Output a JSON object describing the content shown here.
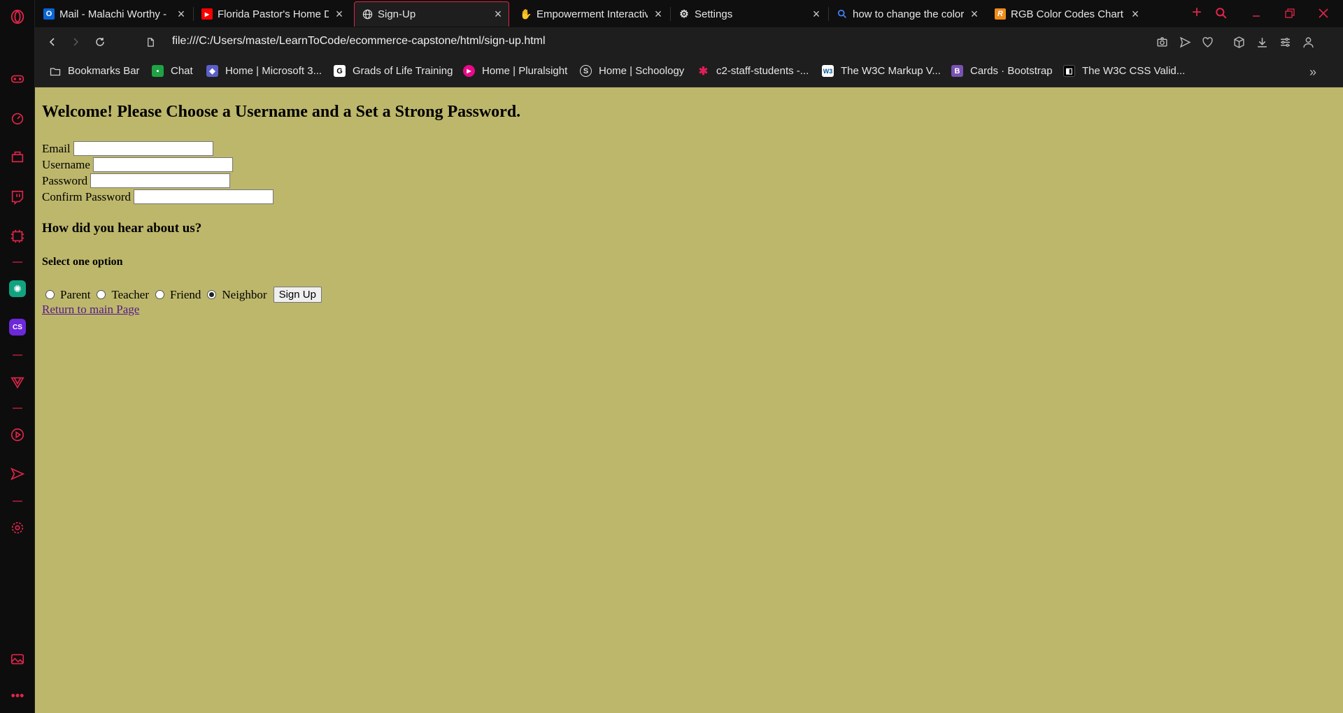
{
  "tabs": [
    {
      "title": "Mail - Malachi Worthy -",
      "icon": "outlook-icon",
      "color": "#0a64d6",
      "glyph": "O"
    },
    {
      "title": "Florida Pastor's Home D",
      "icon": "youtube-icon",
      "color": "#ff0000",
      "glyph": "▶"
    },
    {
      "title": "Sign-Up",
      "icon": "globe-icon",
      "color": "#1e1e1e",
      "glyph": "🌐"
    },
    {
      "title": "Empowerment Interactiv",
      "icon": "hand-icon",
      "color": "#f2b705",
      "glyph": "✋"
    },
    {
      "title": "Settings",
      "icon": "gear-icon",
      "color": "#1e1e1e",
      "glyph": "⚙"
    },
    {
      "title": "how to change the color",
      "icon": "search-icon",
      "color": "#1e1e1e",
      "glyph": "🔍"
    },
    {
      "title": "RGB Color Codes Chart (",
      "icon": "rgb-chart-icon",
      "color": "#f08c1a",
      "glyph": "R"
    }
  ],
  "address": {
    "url": "file:///C:/Users/maste/LearnToCode/ecommerce-capstone/html/sign-up.html"
  },
  "bookmarks": [
    {
      "label": "Bookmarks Bar",
      "icon": "folder-icon",
      "color": "#1e1e1e",
      "glyph": "🗀"
    },
    {
      "label": "Chat",
      "icon": "chat-icon",
      "color": "#1fa345",
      "glyph": "💬"
    },
    {
      "label": "Home | Microsoft 3...",
      "icon": "microsoft-icon",
      "color": "#5b5fc7",
      "glyph": "◆"
    },
    {
      "label": "Grads of Life Training",
      "icon": "grads-icon",
      "color": "#ffffff",
      "glyph": "G"
    },
    {
      "label": "Home | Pluralsight",
      "icon": "pluralsight-icon",
      "color": "#e80a89",
      "glyph": "▶"
    },
    {
      "label": "Home | Schoology",
      "icon": "schoology-icon",
      "color": "#1e1e1e",
      "glyph": "S"
    },
    {
      "label": "c2-staff-students -...",
      "icon": "slack-icon",
      "color": "#1e1e1e",
      "glyph": "✱"
    },
    {
      "label": "The W3C Markup V...",
      "icon": "w3c-icon",
      "color": "#ffffff",
      "glyph": "W3"
    },
    {
      "label": "Cards · Bootstrap",
      "icon": "bootstrap-icon",
      "color": "#7952b3",
      "glyph": "B"
    },
    {
      "label": "The W3C CSS Valid...",
      "icon": "w3c-css-icon",
      "color": "#000000",
      "glyph": "◧"
    }
  ],
  "page": {
    "heading": "Welcome! Please Choose a Username and a Set a Strong Password.",
    "email_label": "Email",
    "username_label": "Username",
    "password_label": "Password",
    "confirm_label": "Confirm Password",
    "question": "How did you hear about us?",
    "select_label": "Select one option",
    "options": [
      {
        "label": "Parent",
        "checked": false
      },
      {
        "label": "Teacher",
        "checked": false
      },
      {
        "label": "Friend",
        "checked": false
      },
      {
        "label": "Neighbor",
        "checked": true
      }
    ],
    "submit_label": "Sign Up",
    "link_label": "Return to main Page",
    "background": "#bdb76b"
  },
  "theme": {
    "accent": "#e0254a"
  }
}
